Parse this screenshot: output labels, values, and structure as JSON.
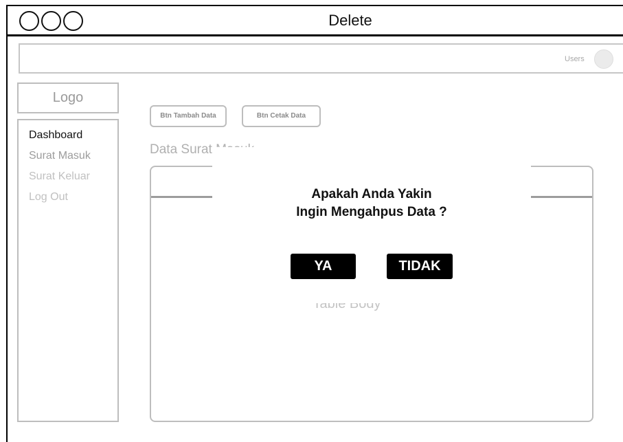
{
  "window": {
    "title": "Delete"
  },
  "header": {
    "user_label": "Users",
    "avatar_icon": "user-avatar-placeholder"
  },
  "sidebar": {
    "logo": "Logo",
    "items": [
      {
        "label": "Dashboard",
        "active": true
      },
      {
        "label": "Surat Masuk",
        "active": false
      },
      {
        "label": "Surat Keluar",
        "active": false
      },
      {
        "label": "Log Out",
        "active": false
      }
    ]
  },
  "toolbar": {
    "add_label": "Btn Tambah Data",
    "print_label": "Btn Cetak Data"
  },
  "main": {
    "title": "Data Surat Masuk",
    "table_body_label": "Table Body"
  },
  "modal": {
    "line1": "Apakah Anda Yakin",
    "line2": "Ingin Mengahpus Data ?",
    "confirm_label": "YA",
    "cancel_label": "TIDAK"
  },
  "colors": {
    "modal_button_bg": "#000000",
    "modal_button_text": "#ffffff"
  }
}
